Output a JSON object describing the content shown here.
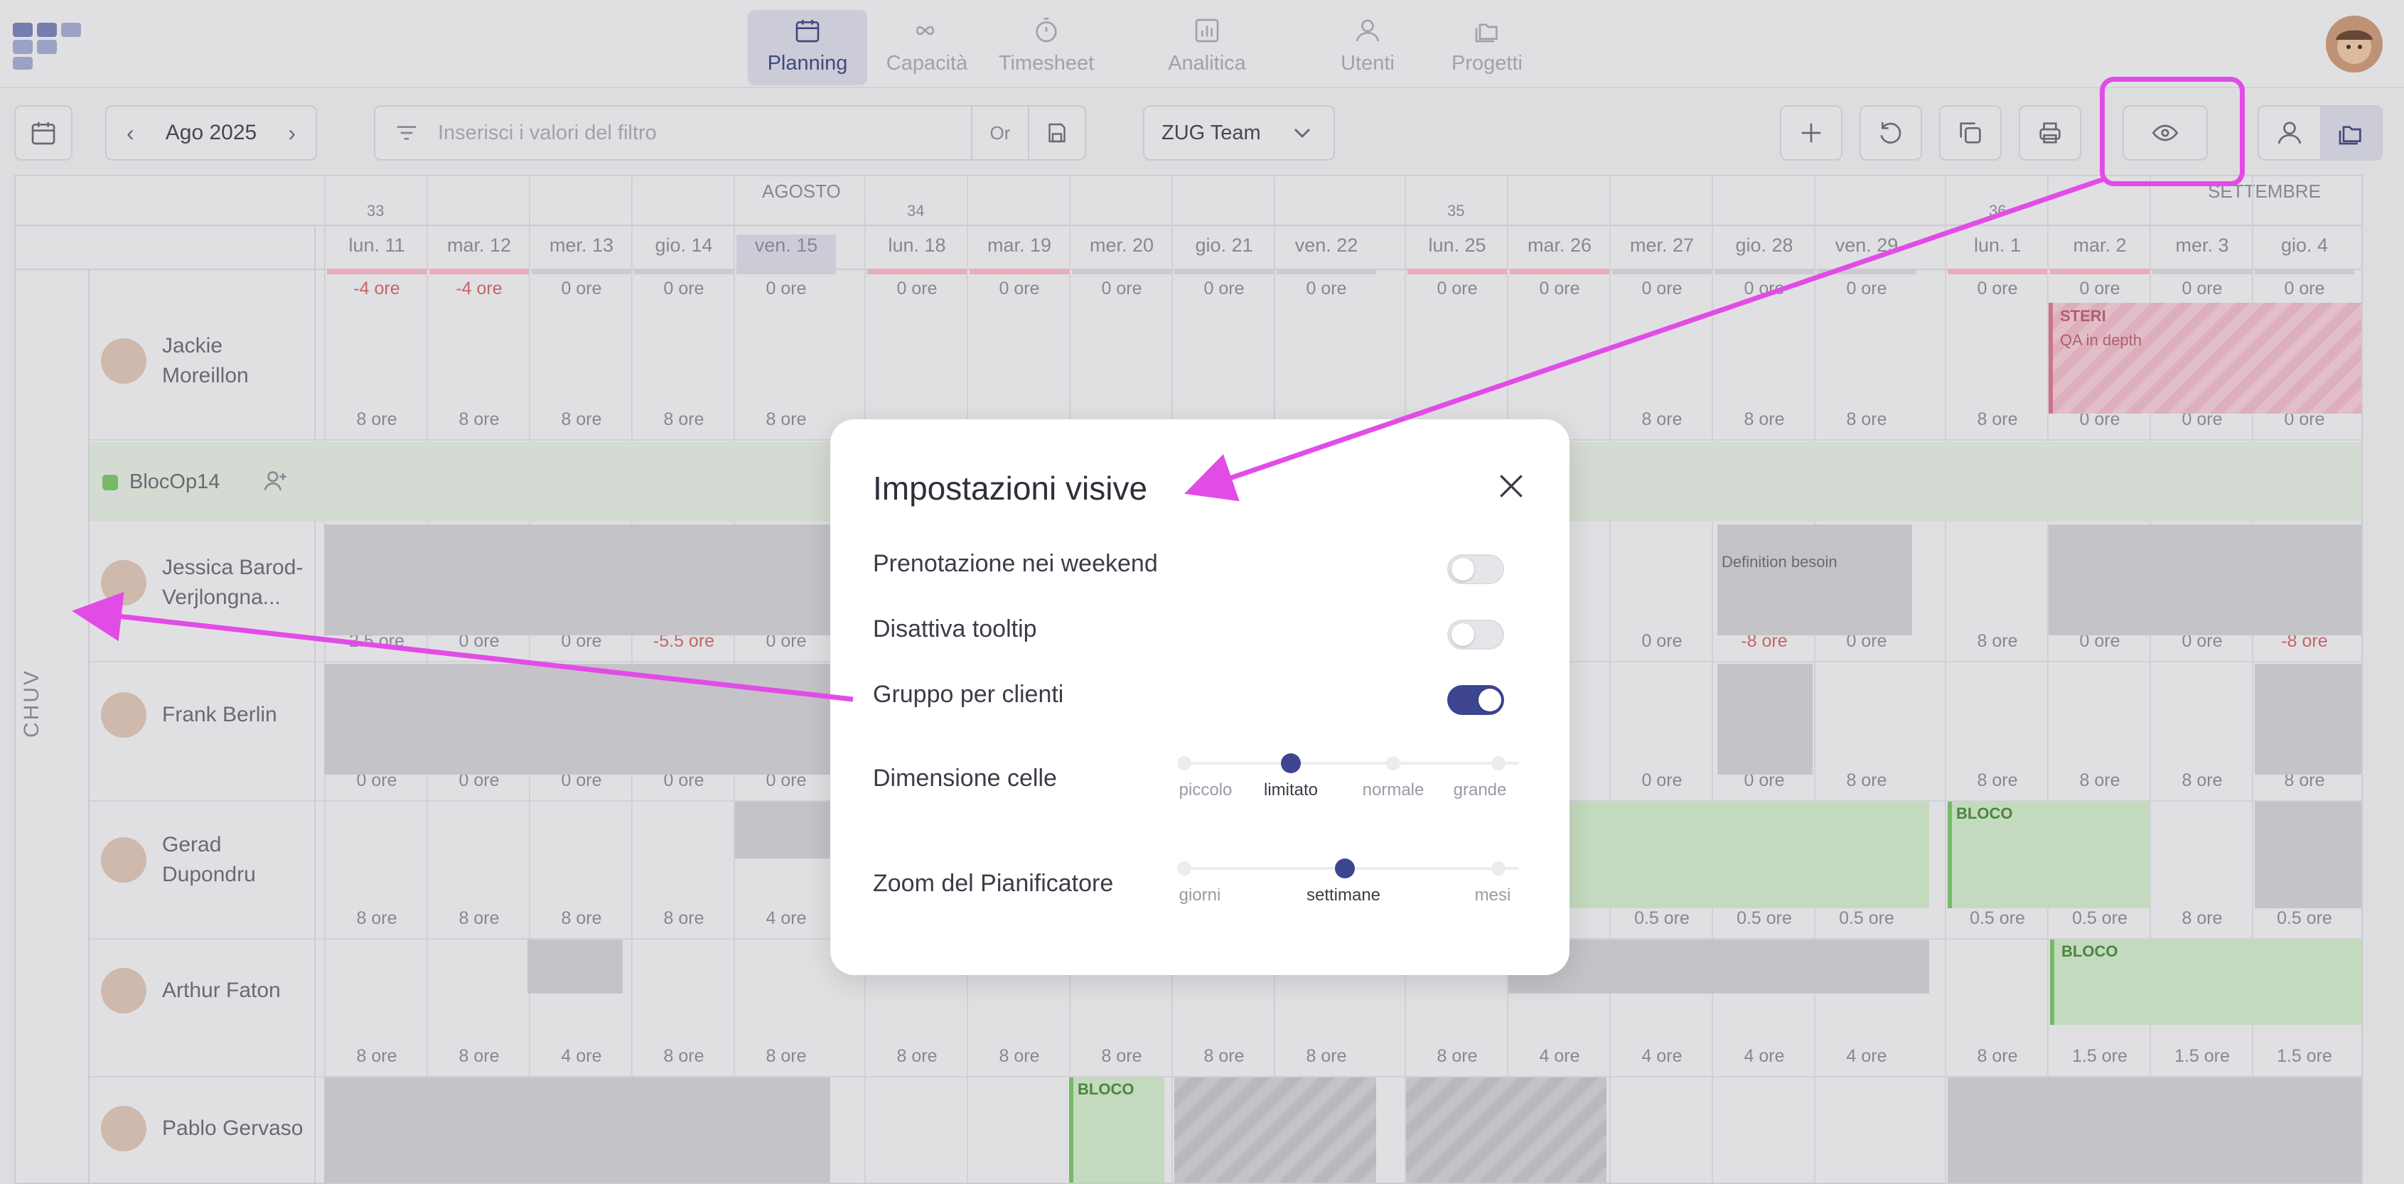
{
  "nav": {
    "items": [
      {
        "label": "Planning",
        "icon": "calendar-icon",
        "active": true
      },
      {
        "label": "Capacità",
        "icon": "infinity-icon"
      },
      {
        "label": "Timesheet",
        "icon": "stopwatch-icon"
      },
      {
        "label": "Analitica",
        "icon": "bar-chart-icon"
      },
      {
        "label": "Utenti",
        "icon": "user-icon"
      },
      {
        "label": "Progetti",
        "icon": "folders-icon"
      }
    ]
  },
  "toolbar": {
    "month": "Ago 2025",
    "filter_placeholder": "Inserisci i valori del filtro",
    "or_label": "Or",
    "team": "ZUG Team"
  },
  "calendar": {
    "months": [
      "AGOSTO",
      "SETTEMBRE"
    ],
    "weeks": [
      "33",
      "34",
      "35",
      "36"
    ],
    "days": [
      "lun. 11",
      "mar. 12",
      "mer. 13",
      "gio. 14",
      "ven. 15",
      "lun. 18",
      "mar. 19",
      "mer. 20",
      "gio. 21",
      "ven. 22",
      "lun. 25",
      "mar. 26",
      "mer. 27",
      "gio. 28",
      "ven. 29",
      "lun. 1",
      "mar. 2",
      "mer. 3",
      "gio. 4"
    ],
    "top_hours": [
      "-4 ore",
      "-4 ore",
      "0 ore",
      "0 ore",
      "0 ore",
      "0 ore",
      "0 ore",
      "0 ore",
      "0 ore",
      "0 ore",
      "0 ore",
      "0 ore",
      "0 ore",
      "0 ore",
      "0 ore",
      "0 ore",
      "0 ore",
      "0 ore",
      "0 ore"
    ],
    "group_label": "CHUV",
    "project_row": "BlocOp14",
    "people": [
      {
        "name": "Jackie Moreillon",
        "hours": [
          "8 ore",
          "8 ore",
          "8 ore",
          "8 ore",
          "8 ore",
          "",
          "",
          "",
          "",
          "",
          "",
          "",
          "8 ore",
          "8 ore",
          "8 ore",
          "8 ore",
          "0 ore",
          "0 ore",
          "0 ore"
        ]
      },
      {
        "name": "Jessica Barod-Verjlongna...",
        "hours": [
          "2.5 ore",
          "0 ore",
          "0 ore",
          "-5.5 ore",
          "0 ore",
          "",
          "",
          "",
          "",
          "",
          "",
          "",
          "0 ore",
          "-8 ore",
          "0 ore",
          "8 ore",
          "0 ore",
          "0 ore",
          "-8 ore"
        ]
      },
      {
        "name": "Frank Berlin",
        "hours": [
          "0 ore",
          "0 ore",
          "0 ore",
          "0 ore",
          "0 ore",
          "",
          "",
          "",
          "",
          "",
          "",
          "",
          "0 ore",
          "0 ore",
          "8 ore",
          "8 ore",
          "8 ore",
          "8 ore",
          "8 ore"
        ]
      },
      {
        "name": "Gerad Dupondru",
        "hours": [
          "8 ore",
          "8 ore",
          "8 ore",
          "8 ore",
          "4 ore",
          "",
          "",
          "",
          "",
          "",
          "",
          "",
          "0.5 ore",
          "0.5 ore",
          "0.5 ore",
          "0.5 ore",
          "0.5 ore",
          "8 ore",
          "0.5 ore"
        ]
      },
      {
        "name": "Arthur Faton",
        "hours": [
          "8 ore",
          "8 ore",
          "4 ore",
          "8 ore",
          "8 ore",
          "8 ore",
          "8 ore",
          "8 ore",
          "8 ore",
          "8 ore",
          "8 ore",
          "4 ore",
          "4 ore",
          "4 ore",
          "4 ore",
          "8 ore",
          "1.5 ore",
          "1.5 ore",
          "1.5 ore"
        ]
      },
      {
        "name": "Pablo Gervaso",
        "hours": []
      }
    ],
    "tags": {
      "steri": "STERI",
      "qa": "QA in depth",
      "bloco": "BLOCO",
      "definition": "Definition besoin"
    }
  },
  "dialog": {
    "title": "Impostazioni visive",
    "weekend": "Prenotazione nei weekend",
    "tooltip": "Disattiva tooltip",
    "group_clients": "Gruppo per clienti",
    "cell_size": "Dimensione celle",
    "cell_size_options": [
      "piccolo",
      "limitato",
      "normale",
      "grande"
    ],
    "cell_size_selected": 1,
    "zoom": "Zoom del Pianificatore",
    "zoom_options": [
      "giorni",
      "settimane",
      "mesi"
    ],
    "zoom_selected": 1,
    "toggles": {
      "weekend": false,
      "tooltip": false,
      "group_clients": true
    }
  }
}
